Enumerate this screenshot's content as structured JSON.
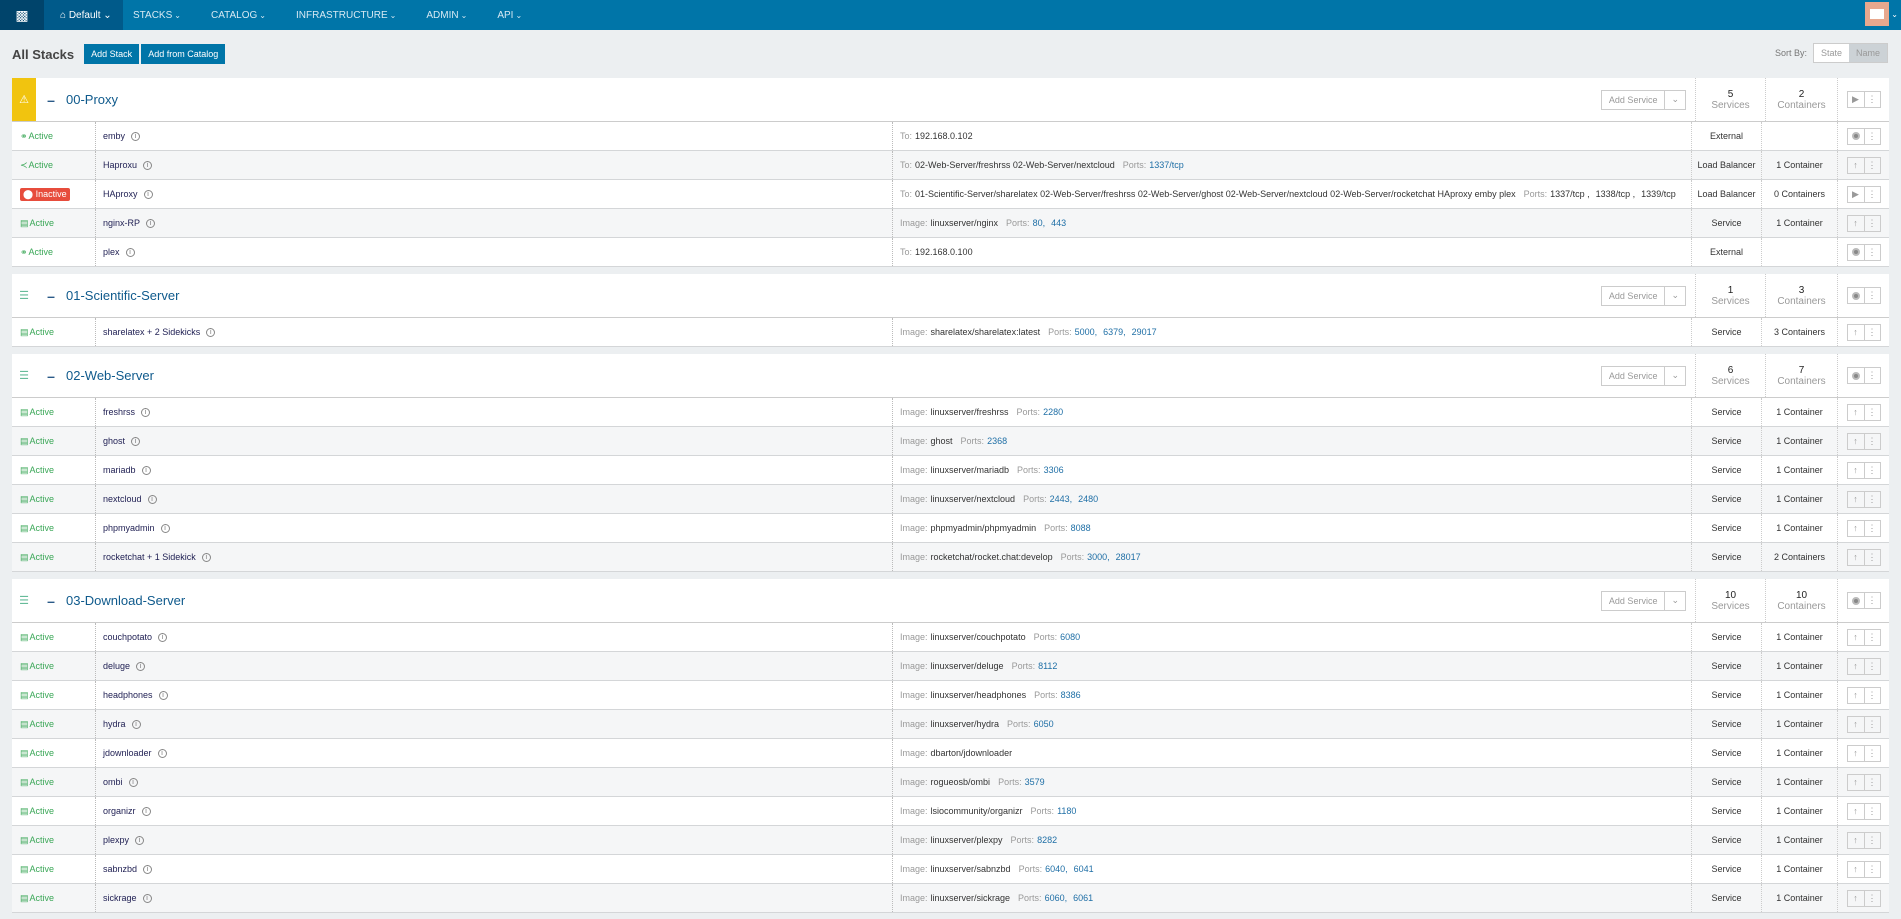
{
  "nav": {
    "environment": "Default",
    "items": [
      "STACKS",
      "CATALOG",
      "INFRASTRUCTURE",
      "ADMIN",
      "API"
    ]
  },
  "header": {
    "title": "All Stacks",
    "add_stack": "Add Stack",
    "add_from_catalog": "Add from Catalog",
    "sort_by": "Sort By:",
    "sort_options": [
      "State",
      "Name"
    ],
    "sort_selected": "Name"
  },
  "colors": {
    "nav": "#0075a8",
    "active": "#3aa757",
    "inactive": "#e74c3c",
    "warning": "#f1c40f"
  },
  "labels": {
    "add_service": "Add Service",
    "services": "Services",
    "containers": "Containers"
  },
  "stacks": [
    {
      "name": "00-Proxy",
      "icon": "warning-icon",
      "services": "5",
      "containers": "2",
      "action": "play",
      "rows": [
        {
          "state": "Active",
          "kind": "external",
          "name": "emby",
          "detail": [
            {
              "l": "To:",
              "v": "192.168.0.102"
            }
          ],
          "type": "External",
          "containers": "",
          "action": "stop"
        },
        {
          "state": "Active",
          "kind": "lb",
          "name": "Haproxu",
          "detail": [
            {
              "l": "To:",
              "v": "02-Web-Server/freshrss  02-Web-Server/nextcloud"
            },
            {
              "l": "Ports:",
              "p": [
                "1337/tcp"
              ]
            }
          ],
          "type": "Load Balancer",
          "containers": "1 Container",
          "action": "upgrade"
        },
        {
          "state": "Inactive",
          "kind": "lb",
          "name": "HAproxy",
          "detail": [
            {
              "l": "To:",
              "v": "01-Scientific-Server/sharelatex  02-Web-Server/freshrss  02-Web-Server/ghost  02-Web-Server/nextcloud  02-Web-Server/rocketchat  HAproxy  emby  plex"
            },
            {
              "l": "Ports:",
              "p": [
                "1337/tcp ,",
                "1338/tcp ,",
                "1339/tcp"
              ],
              "dark": true
            }
          ],
          "type": "Load Balancer",
          "containers": "0 Containers",
          "action": "play"
        },
        {
          "state": "Active",
          "kind": "service",
          "name": "nginx-RP",
          "detail": [
            {
              "l": "Image:",
              "v": "linuxserver/nginx"
            },
            {
              "l": "Ports:",
              "p": [
                "80,",
                "443"
              ]
            }
          ],
          "type": "Service",
          "containers": "1 Container",
          "action": "upgrade"
        },
        {
          "state": "Active",
          "kind": "external",
          "name": "plex",
          "detail": [
            {
              "l": "To:",
              "v": "192.168.0.100"
            }
          ],
          "type": "External",
          "containers": "",
          "action": "stop"
        }
      ]
    },
    {
      "name": "01-Scientific-Server",
      "icon": "layers-icon",
      "services": "1",
      "containers": "3",
      "action": "stop",
      "rows": [
        {
          "state": "Active",
          "kind": "service",
          "name": "sharelatex + 2 Sidekicks",
          "detail": [
            {
              "l": "Image:",
              "v": "sharelatex/sharelatex:latest"
            },
            {
              "l": "Ports:",
              "p": [
                "5000,",
                "6379,",
                "29017"
              ]
            }
          ],
          "type": "Service",
          "containers": "3 Containers",
          "action": "upgrade"
        }
      ]
    },
    {
      "name": "02-Web-Server",
      "icon": "layers-icon",
      "services": "6",
      "containers": "7",
      "action": "stop",
      "rows": [
        {
          "state": "Active",
          "kind": "service",
          "name": "freshrss",
          "detail": [
            {
              "l": "Image:",
              "v": "linuxserver/freshrss"
            },
            {
              "l": "Ports:",
              "p": [
                "2280"
              ]
            }
          ],
          "type": "Service",
          "containers": "1 Container",
          "action": "upgrade"
        },
        {
          "state": "Active",
          "kind": "service",
          "name": "ghost",
          "detail": [
            {
              "l": "Image:",
              "v": "ghost"
            },
            {
              "l": "Ports:",
              "p": [
                "2368"
              ]
            }
          ],
          "type": "Service",
          "containers": "1 Container",
          "action": "upgrade"
        },
        {
          "state": "Active",
          "kind": "service",
          "name": "mariadb",
          "detail": [
            {
              "l": "Image:",
              "v": "linuxserver/mariadb"
            },
            {
              "l": "Ports:",
              "p": [
                "3306"
              ]
            }
          ],
          "type": "Service",
          "containers": "1 Container",
          "action": "upgrade"
        },
        {
          "state": "Active",
          "kind": "service",
          "name": "nextcloud",
          "detail": [
            {
              "l": "Image:",
              "v": "linuxserver/nextcloud"
            },
            {
              "l": "Ports:",
              "p": [
                "2443,",
                "2480"
              ]
            }
          ],
          "type": "Service",
          "containers": "1 Container",
          "action": "upgrade"
        },
        {
          "state": "Active",
          "kind": "service",
          "name": "phpmyadmin",
          "detail": [
            {
              "l": "Image:",
              "v": "phpmyadmin/phpmyadmin"
            },
            {
              "l": "Ports:",
              "p": [
                "8088"
              ]
            }
          ],
          "type": "Service",
          "containers": "1 Container",
          "action": "upgrade"
        },
        {
          "state": "Active",
          "kind": "service",
          "name": "rocketchat + 1 Sidekick",
          "detail": [
            {
              "l": "Image:",
              "v": "rocketchat/rocket.chat:develop"
            },
            {
              "l": "Ports:",
              "p": [
                "3000,",
                "28017"
              ]
            }
          ],
          "type": "Service",
          "containers": "2 Containers",
          "action": "upgrade"
        }
      ]
    },
    {
      "name": "03-Download-Server",
      "icon": "layers-icon",
      "services": "10",
      "containers": "10",
      "action": "stop",
      "rows": [
        {
          "state": "Active",
          "kind": "service",
          "name": "couchpotato",
          "detail": [
            {
              "l": "Image:",
              "v": "linuxserver/couchpotato"
            },
            {
              "l": "Ports:",
              "p": [
                "6080"
              ]
            }
          ],
          "type": "Service",
          "containers": "1 Container",
          "action": "upgrade"
        },
        {
          "state": "Active",
          "kind": "service",
          "name": "deluge",
          "detail": [
            {
              "l": "Image:",
              "v": "linuxserver/deluge"
            },
            {
              "l": "Ports:",
              "p": [
                "8112"
              ]
            }
          ],
          "type": "Service",
          "containers": "1 Container",
          "action": "upgrade"
        },
        {
          "state": "Active",
          "kind": "service",
          "name": "headphones",
          "detail": [
            {
              "l": "Image:",
              "v": "linuxserver/headphones"
            },
            {
              "l": "Ports:",
              "p": [
                "8386"
              ]
            }
          ],
          "type": "Service",
          "containers": "1 Container",
          "action": "upgrade"
        },
        {
          "state": "Active",
          "kind": "service",
          "name": "hydra",
          "detail": [
            {
              "l": "Image:",
              "v": "linuxserver/hydra"
            },
            {
              "l": "Ports:",
              "p": [
                "6050"
              ]
            }
          ],
          "type": "Service",
          "containers": "1 Container",
          "action": "upgrade"
        },
        {
          "state": "Active",
          "kind": "service",
          "name": "jdownloader",
          "detail": [
            {
              "l": "Image:",
              "v": "dbarton/jdownloader"
            }
          ],
          "type": "Service",
          "containers": "1 Container",
          "action": "upgrade"
        },
        {
          "state": "Active",
          "kind": "service",
          "name": "ombi",
          "detail": [
            {
              "l": "Image:",
              "v": "rogueosb/ombi"
            },
            {
              "l": "Ports:",
              "p": [
                "3579"
              ]
            }
          ],
          "type": "Service",
          "containers": "1 Container",
          "action": "upgrade"
        },
        {
          "state": "Active",
          "kind": "service",
          "name": "organizr",
          "detail": [
            {
              "l": "Image:",
              "v": "lsiocommunity/organizr"
            },
            {
              "l": "Ports:",
              "p": [
                "1180"
              ]
            }
          ],
          "type": "Service",
          "containers": "1 Container",
          "action": "upgrade"
        },
        {
          "state": "Active",
          "kind": "service",
          "name": "plexpy",
          "detail": [
            {
              "l": "Image:",
              "v": "linuxserver/plexpy"
            },
            {
              "l": "Ports:",
              "p": [
                "8282"
              ]
            }
          ],
          "type": "Service",
          "containers": "1 Container",
          "action": "upgrade"
        },
        {
          "state": "Active",
          "kind": "service",
          "name": "sabnzbd",
          "detail": [
            {
              "l": "Image:",
              "v": "linuxserver/sabnzbd"
            },
            {
              "l": "Ports:",
              "p": [
                "6040,",
                "6041"
              ]
            }
          ],
          "type": "Service",
          "containers": "1 Container",
          "action": "upgrade"
        },
        {
          "state": "Active",
          "kind": "service",
          "name": "sickrage",
          "detail": [
            {
              "l": "Image:",
              "v": "linuxserver/sickrage"
            },
            {
              "l": "Ports:",
              "p": [
                "6060,",
                "6061"
              ]
            }
          ],
          "type": "Service",
          "containers": "1 Container",
          "action": "upgrade"
        }
      ]
    }
  ]
}
